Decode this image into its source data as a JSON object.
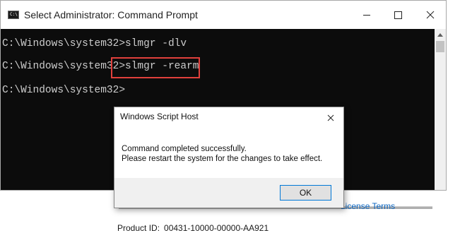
{
  "cmd_window": {
    "title": "Select Administrator: Command Prompt",
    "icon_label": "C:\\",
    "lines": [
      "C:\\Windows\\system32>slmgr -dlv",
      "C:\\Windows\\system32>slmgr -rearm",
      "C:\\Windows\\system32>"
    ],
    "highlight_color": "#e0403c"
  },
  "dialog": {
    "title": "Windows Script Host",
    "message_line1": "Command completed successfully.",
    "message_line2": "Please restart the system for the changes to take effect.",
    "ok_label": "OK"
  },
  "background": {
    "license_link": "License Terms",
    "product_id_label": "Product ID:",
    "product_id_value": "00431-10000-00000-AA921",
    "link_color": "#0b66c2"
  },
  "icons": [
    "minimize-icon",
    "maximize-icon",
    "close-icon",
    "command-prompt-icon"
  ]
}
